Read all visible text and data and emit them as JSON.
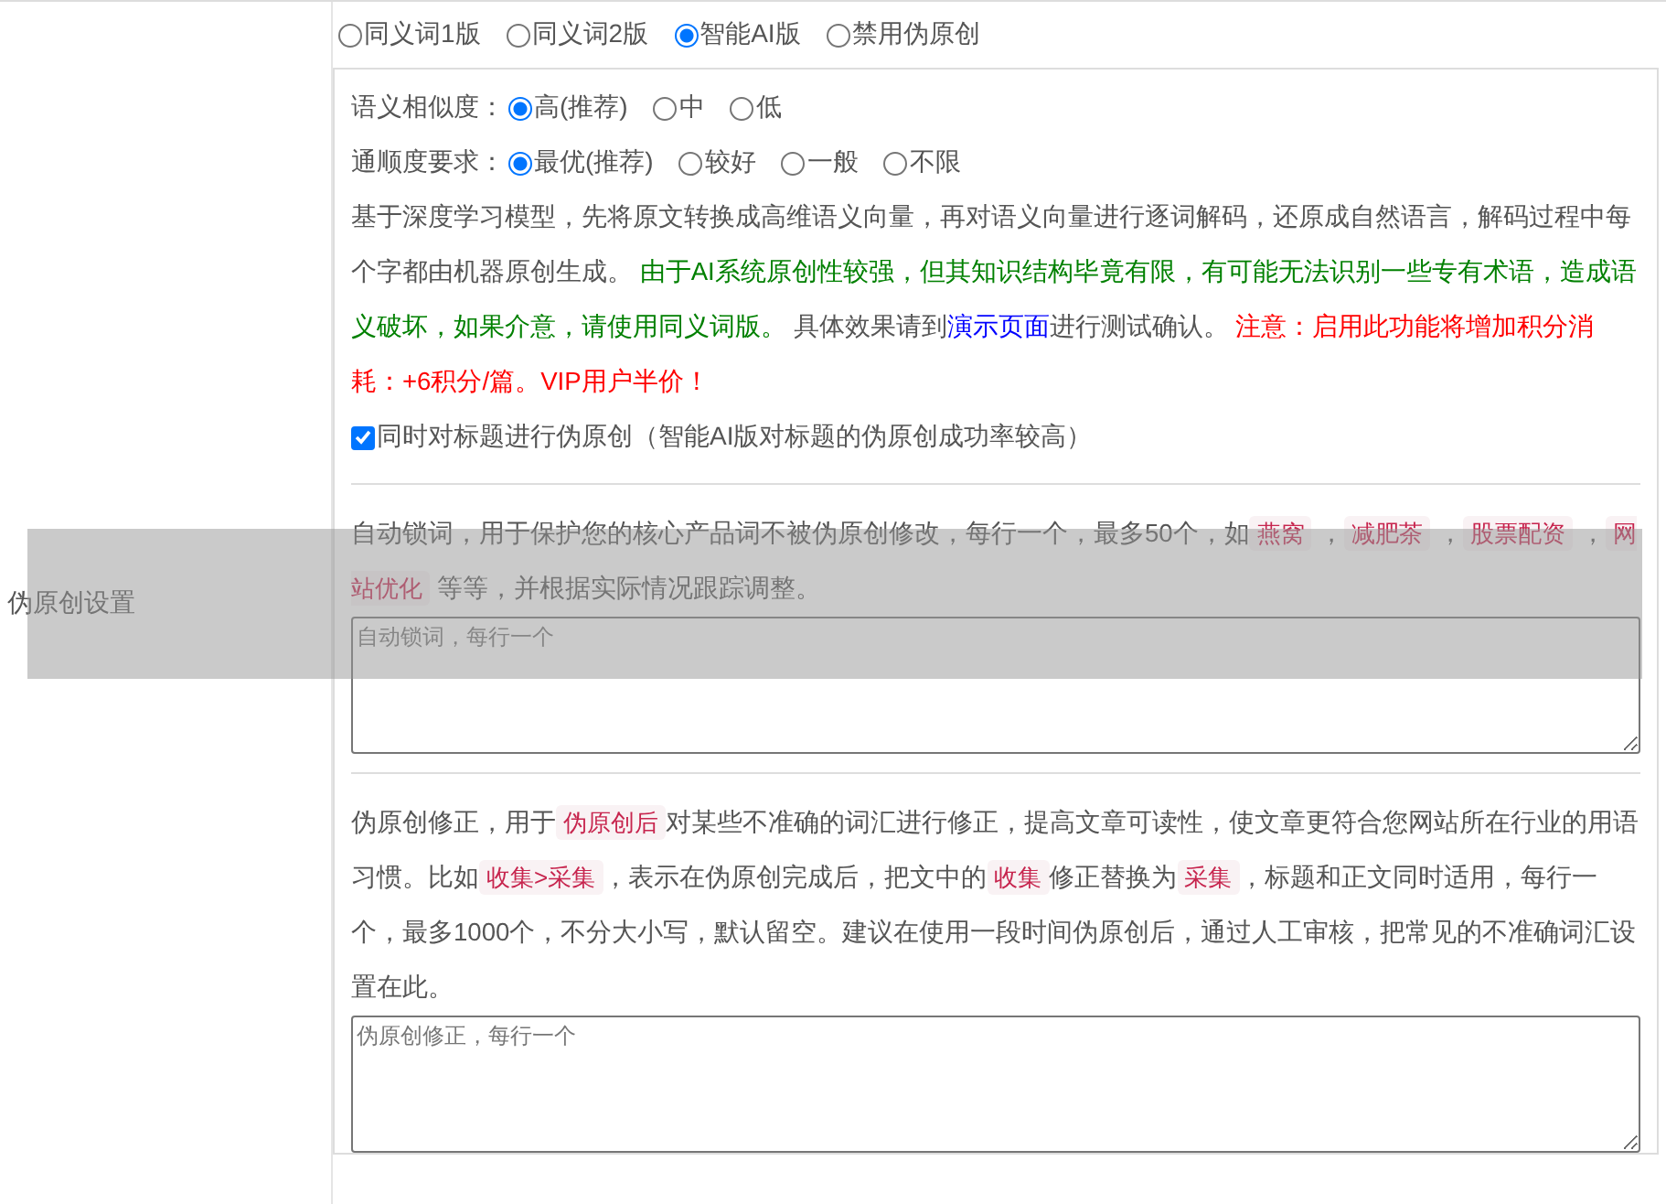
{
  "side_label": "伪原创设置",
  "mode_options": [
    {
      "label": "同义词1版",
      "selected": false
    },
    {
      "label": "同义词2版",
      "selected": false
    },
    {
      "label": "智能AI版",
      "selected": true
    },
    {
      "label": "禁用伪原创",
      "selected": false
    }
  ],
  "similarity": {
    "label": "语义相似度：",
    "options": [
      {
        "label": "高(推荐)",
        "selected": true
      },
      {
        "label": "中",
        "selected": false
      },
      {
        "label": "低",
        "selected": false
      }
    ]
  },
  "fluency": {
    "label": "通顺度要求：",
    "options": [
      {
        "label": "最优(推荐)",
        "selected": true
      },
      {
        "label": "较好",
        "selected": false
      },
      {
        "label": "一般",
        "selected": false
      },
      {
        "label": "不限",
        "selected": false
      }
    ]
  },
  "description": [
    {
      "kind": "plain",
      "text": "基于深度学习模型，先将原文转换成高维语义向量，再对语义向量进行逐词解码，还原成自然语言，解码过程中每个字都由机器原创生成。 "
    },
    {
      "kind": "green",
      "text": "由于AI系统原创性较强，但其知识结构毕竟有限，有可能无法识别一些专有术语，造成语义破坏，如果介意，请使用同义词版。"
    },
    {
      "kind": "plain",
      "text": " 具体效果请到"
    },
    {
      "kind": "link",
      "text": "演示页面"
    },
    {
      "kind": "plain",
      "text": "进行测试确认。 "
    },
    {
      "kind": "red",
      "text": "注意：启用此功能将增加积分消耗：+6积分/篇。VIP用户半价！"
    }
  ],
  "title_checkbox": {
    "label": "同时对标题进行伪原创（智能AI版对标题的伪原创成功率较高）",
    "checked": true
  },
  "lock_words": {
    "description": [
      {
        "kind": "plain",
        "text": "自动锁词，用于保护您的核心产品词不被伪原创修改，每行一个，最多50个，如"
      },
      {
        "kind": "tag",
        "text": "燕窝"
      },
      {
        "kind": "plain",
        "text": " ，"
      },
      {
        "kind": "tag",
        "text": "减肥茶"
      },
      {
        "kind": "plain",
        "text": " ，"
      },
      {
        "kind": "tag",
        "text": "股票配资"
      },
      {
        "kind": "plain",
        "text": " ，"
      },
      {
        "kind": "tag",
        "text": "网站优化"
      },
      {
        "kind": "plain",
        "text": " 等等，并根据实际情况跟踪调整。"
      }
    ],
    "placeholder": "自动锁词，每行一个"
  },
  "correction": {
    "description": [
      {
        "kind": "plain",
        "text": "伪原创修正，用于"
      },
      {
        "kind": "tag",
        "text": "伪原创后"
      },
      {
        "kind": "plain",
        "text": "对某些不准确的词汇进行修正，提高文章可读性，使文章更符合您网站所在行业的用语习惯。比如"
      },
      {
        "kind": "tag",
        "text": "收集>采集"
      },
      {
        "kind": "plain",
        "text": "，表示在伪原创完成后，把文中的"
      },
      {
        "kind": "tag",
        "text": "收集"
      },
      {
        "kind": "plain",
        "text": "修正替换为"
      },
      {
        "kind": "tag",
        "text": "采集"
      },
      {
        "kind": "plain",
        "text": "，标题和正文同时适用，每行一个，最多1000个，不分大小写，默认留空。建议在使用一段时间伪原创后，通过人工审核，把常见的不准确词汇设置在此。"
      }
    ],
    "placeholder": "伪原创修正，每行一个"
  }
}
